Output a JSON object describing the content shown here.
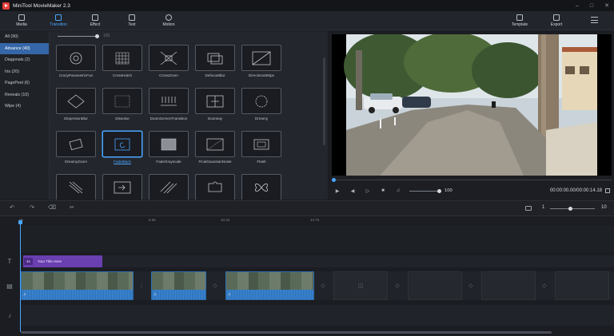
{
  "app": {
    "title": "MiniTool MovieMaker 2.3"
  },
  "toolbar": {
    "media": "Media",
    "transition": "Transition",
    "effect": "Effect",
    "text": "Text",
    "motion": "Motion",
    "template": "Template",
    "export": "Export"
  },
  "categories": [
    "All (90)",
    "Advance (40)",
    "Diagonals (2)",
    "Iris (20)",
    "PagePeel (6)",
    "Reveals (10)",
    "Wipe (4)"
  ],
  "gallery": {
    "zoom_value": "100",
    "transitions": [
      {
        "label": "CrazyParametricFun",
        "icon": "crazy-parametric-icon"
      },
      {
        "label": "CrossHatch",
        "icon": "crosshatch-icon"
      },
      {
        "label": "CrossZoom",
        "icon": "crosszoom-icon"
      },
      {
        "label": "DefocusBlur",
        "icon": "defocus-blur-icon"
      },
      {
        "label": "DirectionalWipe",
        "icon": "directional-wipe-icon"
      },
      {
        "label": "DispersionBlur",
        "icon": "dispersion-blur-icon"
      },
      {
        "label": "Dissolve",
        "icon": "dissolve-icon"
      },
      {
        "label": "DoomScreenTransition",
        "icon": "doom-screen-icon"
      },
      {
        "label": "Doorway",
        "icon": "doorway-icon"
      },
      {
        "label": "Dreamy",
        "icon": "dreamy-icon"
      },
      {
        "label": "DreamyZoom",
        "icon": "dreamy-zoom-icon"
      },
      {
        "label": "FadeBlack",
        "icon": "fade-black-icon"
      },
      {
        "label": "FadeGrayscale",
        "icon": "fade-grayscale-icon"
      },
      {
        "label": "FinalGaussianNoise",
        "icon": "gaussian-noise-icon"
      },
      {
        "label": "Flash",
        "icon": "flash-icon"
      },
      {
        "label": "",
        "icon": "stripes-icon"
      },
      {
        "label": "",
        "icon": "arrow-slide-icon"
      },
      {
        "label": "",
        "icon": "diagonal-stripes-icon"
      },
      {
        "label": "",
        "icon": "puzzle-icon"
      },
      {
        "label": "",
        "icon": "butterfly-icon"
      }
    ],
    "selected_index": 11
  },
  "player": {
    "volume": "100",
    "timecode": "00:00:00.00/00:00:14.18"
  },
  "timeline": {
    "zoom_min": "1",
    "zoom_max": "10",
    "ruler": [
      "0s",
      "5.5s",
      "10.2s",
      "14.7s"
    ],
    "title_clip": {
      "duration": "4s",
      "text": "Your Title Here"
    }
  }
}
